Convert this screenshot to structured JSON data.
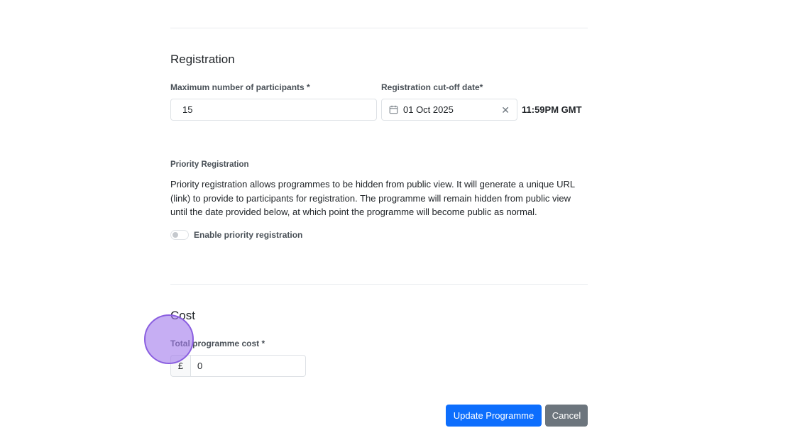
{
  "registration": {
    "title": "Registration",
    "max_participants_label": "Maximum number of participants *",
    "max_participants_value": "15",
    "cutoff_label": "Registration cut-off date*",
    "cutoff_date_value": "01 Oct 2025",
    "cutoff_time": "11:59PM GMT"
  },
  "priority": {
    "label": "Priority Registration",
    "description": "Priority registration allows programmes to be hidden from public view. It will generate a unique URL (link) to provide to participants for registration. The programme will remain hidden from public view until the date provided below, at which point the programme will become public as normal.",
    "toggle_label": "Enable priority registration",
    "toggle_enabled": false
  },
  "cost": {
    "title": "Cost",
    "total_label": "Total programme cost *",
    "currency_symbol": "£",
    "total_value": "0"
  },
  "actions": {
    "update_label": "Update Programme",
    "cancel_label": "Cancel"
  },
  "icons": {
    "calendar": "calendar-icon",
    "clear": "close-icon"
  },
  "colors": {
    "primary": "#0d6efd",
    "secondary": "#6c757d",
    "click_marker": "#a078eb"
  }
}
